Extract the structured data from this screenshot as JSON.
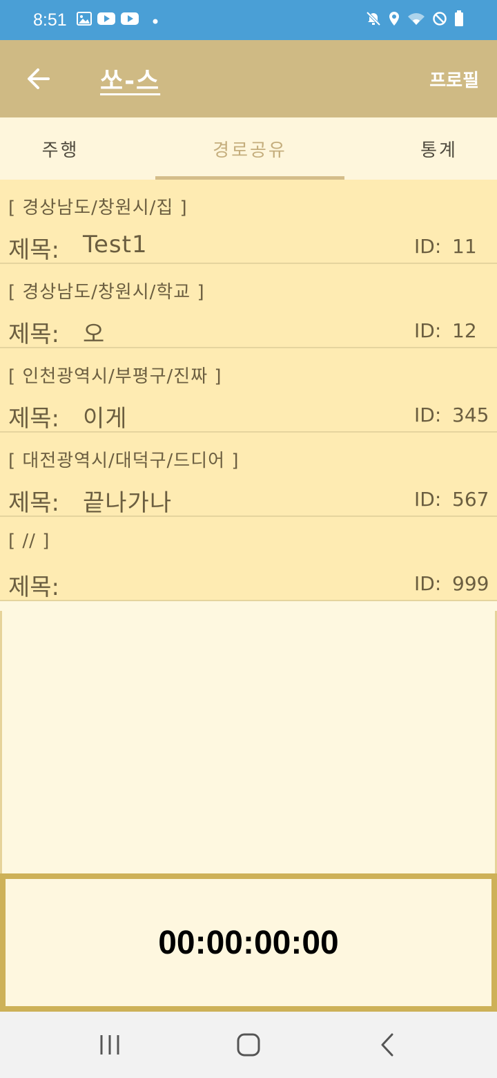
{
  "status_bar": {
    "time": "8:51",
    "left_icons": [
      "image-icon",
      "youtube-icon",
      "youtube-icon",
      "dot-icon"
    ],
    "right_icons": [
      "mute-icon",
      "location-icon",
      "wifi-icon",
      "blocked-icon",
      "battery-icon"
    ]
  },
  "app_bar": {
    "back_icon": "arrow-left-icon",
    "title": "쏘-스",
    "profile_label": "프로필"
  },
  "tabs": [
    {
      "label": "주행",
      "selected": false
    },
    {
      "label": "경로공유",
      "selected": true
    },
    {
      "label": "통계",
      "selected": false
    }
  ],
  "routes": [
    {
      "region": "[ 경상남도/창원시/집 ]",
      "title_label": "제목:",
      "title": "Test1",
      "id_label": "ID:",
      "id": "11"
    },
    {
      "region": "[ 경상남도/창원시/학교 ]",
      "title_label": "제목:",
      "title": "오",
      "id_label": "ID:",
      "id": "12"
    },
    {
      "region": "[ 인천광역시/부평구/진짜 ]",
      "title_label": "제목:",
      "title": "이게",
      "id_label": "ID:",
      "id": "345"
    },
    {
      "region": "[ 대전광역시/대덕구/드디어 ]",
      "title_label": "제목:",
      "title": "끝나가나",
      "id_label": "ID:",
      "id": "567"
    },
    {
      "region": "[ // ]",
      "title_label": "제목:",
      "title": "",
      "id_label": "ID:",
      "id": "999"
    }
  ],
  "timer": "00:00:00:00",
  "nav_bar": {
    "recent_icon": "recent-apps-icon",
    "home_icon": "home-icon",
    "back_icon": "back-icon"
  },
  "colors": {
    "status_bar": "#4a9fd6",
    "app_bar": "#cfba84",
    "list_item": "#feebb2",
    "selected_tab": "#c4ad7c",
    "timer_border": "#cdb158"
  }
}
